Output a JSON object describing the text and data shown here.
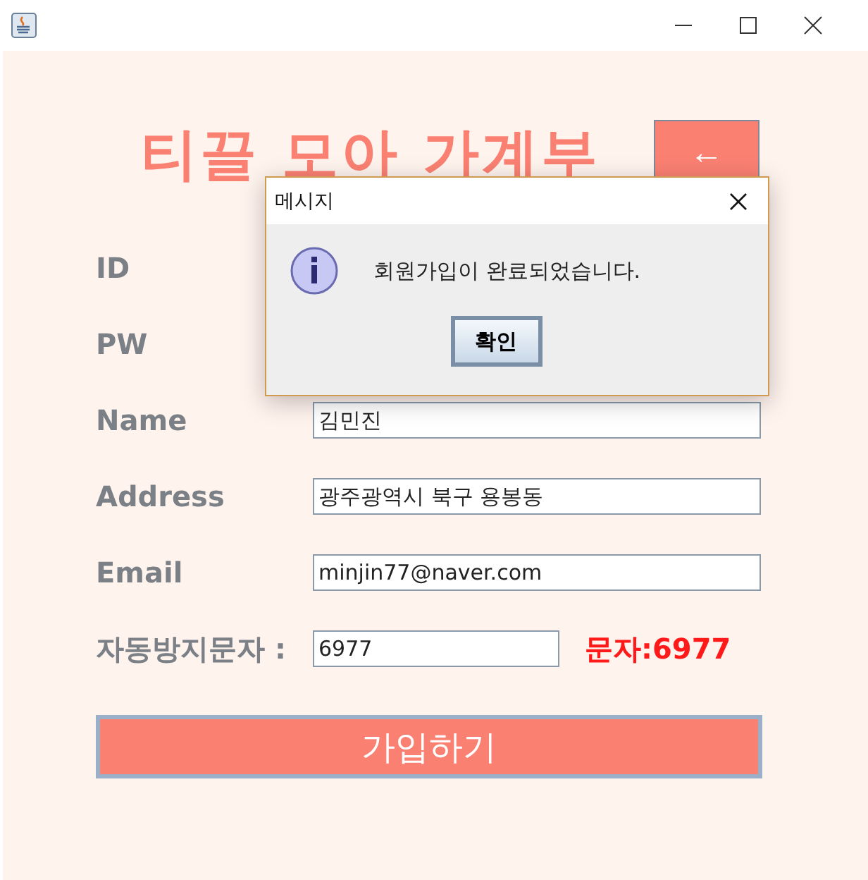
{
  "app_title": "티끌 모아 가계부",
  "back_button": "←",
  "fields": [
    {
      "label": "ID"
    },
    {
      "label": "PW"
    },
    {
      "label": "Name",
      "value": "김민진",
      "kind": "wide"
    },
    {
      "label": "Address",
      "value": "광주광역시 북구 용봉동",
      "kind": "wide"
    },
    {
      "label": "Email",
      "value": "minjin77@naver.com",
      "kind": "wide"
    },
    {
      "label": "자동방지문자 :",
      "value": "6977",
      "kind": "captcha",
      "hint": "문자:6977"
    }
  ],
  "join_button": "가입하기",
  "dialog": {
    "title": "메시지",
    "message": "회원가입이 완료되었습니다.",
    "ok_button": "확인"
  }
}
